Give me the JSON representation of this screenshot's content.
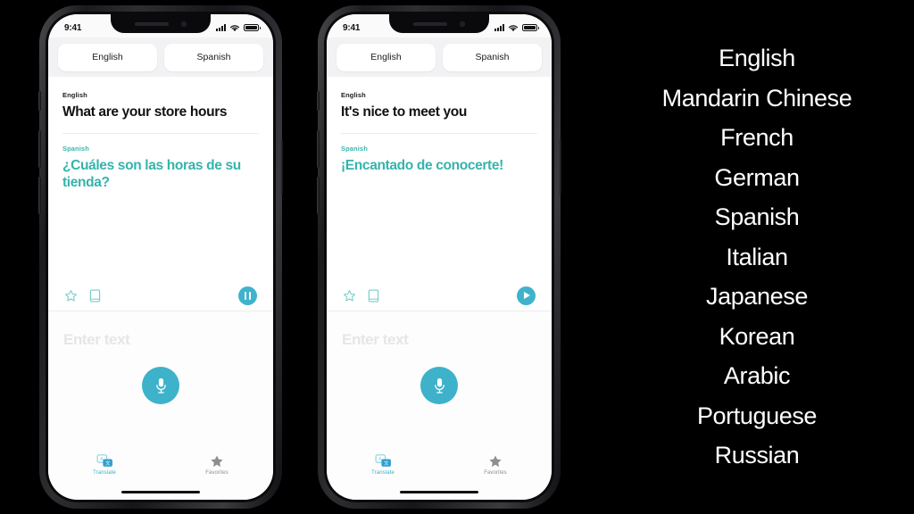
{
  "theme": {
    "background": "#000000",
    "accent_teal": "#35b3ad",
    "accent_blue": "#3db2ca",
    "text_dark": "#111114",
    "text_muted": "#8e8e93",
    "placeholder": "#e6e6e8",
    "header_bg": "#f2f2f4"
  },
  "phones": [
    {
      "status_bar": {
        "time": "9:41",
        "signal_icon": "cellular-bars-icon",
        "wifi_icon": "wifi-icon",
        "battery_icon": "battery-full-icon"
      },
      "language_selector": {
        "source_label": "English",
        "target_label": "Spanish"
      },
      "translation": {
        "source_language": "English",
        "source_text": "What are your store hours",
        "target_language": "Spanish",
        "target_text": "¿Cuáles son las horas de su tienda?"
      },
      "actions": {
        "favorite_icon": "star-outline-icon",
        "dictionary_icon": "book-icon",
        "playback_icon": "pause-icon",
        "playback_state": "playing"
      },
      "input": {
        "placeholder": "Enter text",
        "mic_icon": "microphone-icon"
      },
      "tabs": [
        {
          "label": "Translate",
          "icon": "translate-bubbles-icon",
          "active": true
        },
        {
          "label": "Favorites",
          "icon": "star-filled-icon",
          "active": false
        }
      ]
    },
    {
      "status_bar": {
        "time": "9:41",
        "signal_icon": "cellular-bars-icon",
        "wifi_icon": "wifi-icon",
        "battery_icon": "battery-full-icon"
      },
      "language_selector": {
        "source_label": "English",
        "target_label": "Spanish"
      },
      "translation": {
        "source_language": "English",
        "source_text": "It's nice to meet you",
        "target_language": "Spanish",
        "target_text": "¡Encantado de conocerte!"
      },
      "actions": {
        "favorite_icon": "star-outline-icon",
        "dictionary_icon": "book-icon",
        "playback_icon": "play-icon",
        "playback_state": "paused"
      },
      "input": {
        "placeholder": "Enter text",
        "mic_icon": "microphone-icon"
      },
      "tabs": [
        {
          "label": "Translate",
          "icon": "translate-bubbles-icon",
          "active": true
        },
        {
          "label": "Favorites",
          "icon": "star-filled-icon",
          "active": false
        }
      ]
    }
  ],
  "language_list": {
    "items": [
      "English",
      "Mandarin Chinese",
      "French",
      "German",
      "Spanish",
      "Italian",
      "Japanese",
      "Korean",
      "Arabic",
      "Portuguese",
      "Russian"
    ]
  }
}
